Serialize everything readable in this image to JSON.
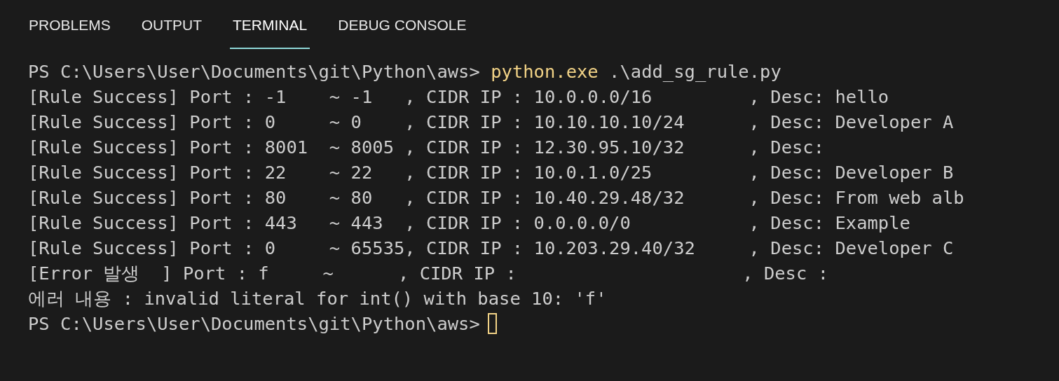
{
  "tabs": [
    {
      "label": "PROBLEMS",
      "selected": false
    },
    {
      "label": "OUTPUT",
      "selected": false
    },
    {
      "label": "TERMINAL",
      "selected": true
    },
    {
      "label": "DEBUG CONSOLE",
      "selected": false
    }
  ],
  "terminal": {
    "lines": [
      {
        "kind": "prompt",
        "prompt": "PS C:\\Users\\User\\Documents\\git\\Python\\aws>",
        "command": "python.exe",
        "args": ".\\add_sg_rule.py",
        "cursor": false
      },
      {
        "kind": "output",
        "text": "[Rule Success] Port : -1    ~ -1   , CIDR IP : 10.0.0.0/16         , Desc: hello"
      },
      {
        "kind": "output",
        "text": "[Rule Success] Port : 0     ~ 0    , CIDR IP : 10.10.10.10/24      , Desc: Developer A"
      },
      {
        "kind": "output",
        "text": "[Rule Success] Port : 8001  ~ 8005 , CIDR IP : 12.30.95.10/32      , Desc:"
      },
      {
        "kind": "output",
        "text": "[Rule Success] Port : 22    ~ 22   , CIDR IP : 10.0.1.0/25         , Desc: Developer B"
      },
      {
        "kind": "output",
        "text": "[Rule Success] Port : 80    ~ 80   , CIDR IP : 10.40.29.48/32      , Desc: From web alb"
      },
      {
        "kind": "output",
        "text": "[Rule Success] Port : 443   ~ 443  , CIDR IP : 0.0.0.0/0           , Desc: Example"
      },
      {
        "kind": "output",
        "text": "[Rule Success] Port : 0     ~ 65535, CIDR IP : 10.203.29.40/32     , Desc: Developer C"
      },
      {
        "kind": "output",
        "text": "[Error 발생  ] Port : f     ~      , CIDR IP :                     , Desc :"
      },
      {
        "kind": "output",
        "text": "에러 내용 : invalid literal for int() with base 10: 'f'"
      },
      {
        "kind": "prompt",
        "prompt": "PS C:\\Users\\User\\Documents\\git\\Python\\aws>",
        "cursor": true
      }
    ]
  }
}
